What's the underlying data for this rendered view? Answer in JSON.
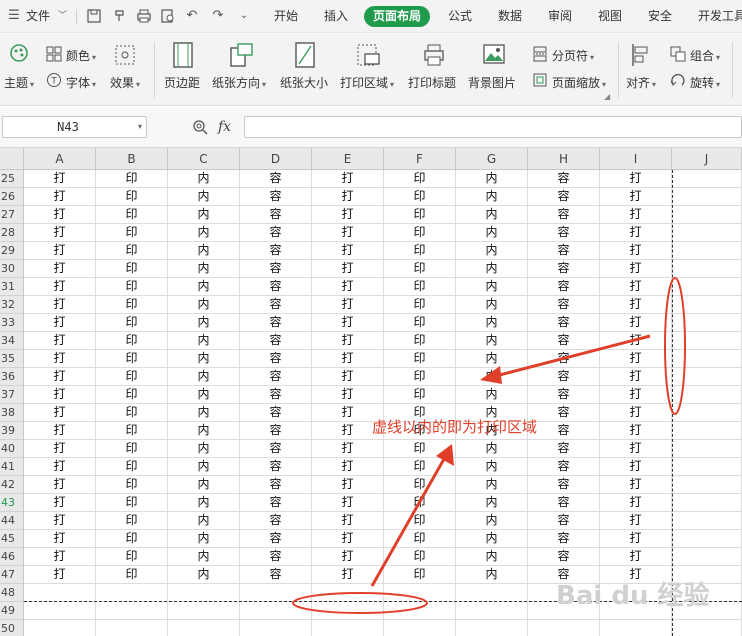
{
  "menubar": {
    "file_label": "文件",
    "tabs": [
      "开始",
      "插入",
      "页面布局",
      "公式",
      "数据",
      "审阅",
      "视图",
      "安全",
      "开发工具"
    ],
    "active_tab": "页面布局"
  },
  "ribbon": {
    "theme": "主题",
    "colors": "颜色",
    "font": "字体",
    "effects": "效果",
    "margins": "页边距",
    "orientation": "纸张方向",
    "paper_size": "纸张大小",
    "print_area": "打印区域",
    "print_titles": "打印标题",
    "background": "背景图片",
    "page_break": "分页符",
    "page_zoom": "页面缩放",
    "align": "对齐",
    "group": "组合",
    "rotate": "旋转"
  },
  "formula_bar": {
    "name_box": "N43",
    "fx": "fx",
    "formula": ""
  },
  "grid": {
    "columns": [
      "A",
      "B",
      "C",
      "D",
      "E",
      "F",
      "G",
      "H",
      "I",
      "J"
    ],
    "rows": [
      {
        "num": "25",
        "cells": [
          "打",
          "印",
          "内",
          "容",
          "打",
          "印",
          "内",
          "容",
          "打",
          ""
        ]
      },
      {
        "num": "26",
        "cells": [
          "打",
          "印",
          "内",
          "容",
          "打",
          "印",
          "内",
          "容",
          "打",
          ""
        ]
      },
      {
        "num": "27",
        "cells": [
          "打",
          "印",
          "内",
          "容",
          "打",
          "印",
          "内",
          "容",
          "打",
          ""
        ]
      },
      {
        "num": "28",
        "cells": [
          "打",
          "印",
          "内",
          "容",
          "打",
          "印",
          "内",
          "容",
          "打",
          ""
        ]
      },
      {
        "num": "29",
        "cells": [
          "打",
          "印",
          "内",
          "容",
          "打",
          "印",
          "内",
          "容",
          "打",
          ""
        ]
      },
      {
        "num": "30",
        "cells": [
          "打",
          "印",
          "内",
          "容",
          "打",
          "印",
          "内",
          "容",
          "打",
          ""
        ]
      },
      {
        "num": "31",
        "cells": [
          "打",
          "印",
          "内",
          "容",
          "打",
          "印",
          "内",
          "容",
          "打",
          ""
        ]
      },
      {
        "num": "32",
        "cells": [
          "打",
          "印",
          "内",
          "容",
          "打",
          "印",
          "内",
          "容",
          "打",
          ""
        ]
      },
      {
        "num": "33",
        "cells": [
          "打",
          "印",
          "内",
          "容",
          "打",
          "印",
          "内",
          "容",
          "打",
          ""
        ]
      },
      {
        "num": "34",
        "cells": [
          "打",
          "印",
          "内",
          "容",
          "打",
          "印",
          "内",
          "容",
          "打",
          ""
        ]
      },
      {
        "num": "35",
        "cells": [
          "打",
          "印",
          "内",
          "容",
          "打",
          "印",
          "内",
          "容",
          "打",
          ""
        ]
      },
      {
        "num": "36",
        "cells": [
          "打",
          "印",
          "内",
          "容",
          "打",
          "印",
          "内",
          "容",
          "打",
          ""
        ]
      },
      {
        "num": "37",
        "cells": [
          "打",
          "印",
          "内",
          "容",
          "打",
          "印",
          "内",
          "容",
          "打",
          ""
        ]
      },
      {
        "num": "38",
        "cells": [
          "打",
          "印",
          "内",
          "容",
          "打",
          "印",
          "内",
          "容",
          "打",
          ""
        ]
      },
      {
        "num": "39",
        "cells": [
          "打",
          "印",
          "内",
          "容",
          "打",
          "印",
          "内",
          "容",
          "打",
          ""
        ]
      },
      {
        "num": "40",
        "cells": [
          "打",
          "印",
          "内",
          "容",
          "打",
          "印",
          "内",
          "容",
          "打",
          ""
        ]
      },
      {
        "num": "41",
        "cells": [
          "打",
          "印",
          "内",
          "容",
          "打",
          "印",
          "内",
          "容",
          "打",
          ""
        ]
      },
      {
        "num": "42",
        "cells": [
          "打",
          "印",
          "内",
          "容",
          "打",
          "印",
          "内",
          "容",
          "打",
          ""
        ]
      },
      {
        "num": "43",
        "cells": [
          "打",
          "印",
          "内",
          "容",
          "打",
          "印",
          "内",
          "容",
          "打",
          ""
        ]
      },
      {
        "num": "44",
        "cells": [
          "打",
          "印",
          "内",
          "容",
          "打",
          "印",
          "内",
          "容",
          "打",
          ""
        ]
      },
      {
        "num": "45",
        "cells": [
          "打",
          "印",
          "内",
          "容",
          "打",
          "印",
          "内",
          "容",
          "打",
          ""
        ]
      },
      {
        "num": "46",
        "cells": [
          "打",
          "印",
          "内",
          "容",
          "打",
          "印",
          "内",
          "容",
          "打",
          ""
        ]
      },
      {
        "num": "47",
        "cells": [
          "打",
          "印",
          "内",
          "容",
          "打",
          "印",
          "内",
          "容",
          "打",
          ""
        ]
      },
      {
        "num": "48",
        "cells": [
          "",
          "",
          "",
          "",
          "",
          "",
          "",
          "",
          "",
          ""
        ]
      },
      {
        "num": "49",
        "cells": [
          "",
          "",
          "",
          "",
          "",
          "",
          "",
          "",
          "",
          ""
        ]
      },
      {
        "num": "50",
        "cells": [
          "",
          "",
          "",
          "",
          "",
          "",
          "",
          "",
          "",
          ""
        ]
      }
    ],
    "active_row": "43"
  },
  "annotation": {
    "text": "虚线以内的即为打印区域",
    "color": "#e0402a"
  },
  "watermark": "Bai du 经验",
  "colors": {
    "accent": "#1f9b4c",
    "annotation": "#e0402a"
  }
}
